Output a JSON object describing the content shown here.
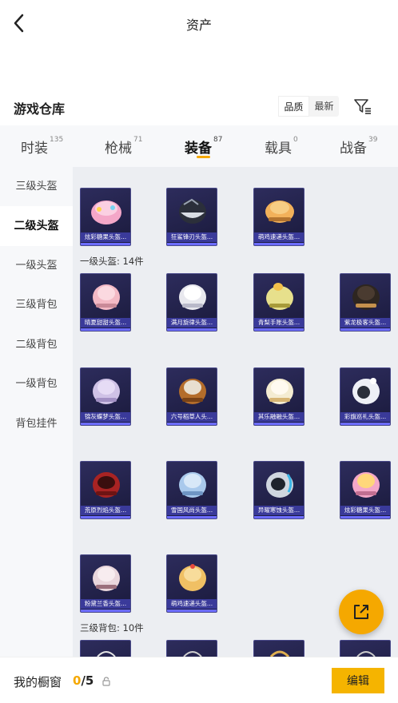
{
  "header": {
    "title": "资产",
    "back_icon": "chevron-left-icon"
  },
  "warehouse": {
    "title": "游戏仓库",
    "sort_options": [
      "品质",
      "最新"
    ],
    "filter_icon": "filter-icon"
  },
  "tabs": [
    {
      "label": "时装",
      "count": "135"
    },
    {
      "label": "枪械",
      "count": "71"
    },
    {
      "label": "装备",
      "count": "87",
      "active": true
    },
    {
      "label": "载具",
      "count": "0"
    },
    {
      "label": "战备",
      "count": "39"
    }
  ],
  "sidebar": [
    {
      "label": "三级头盔"
    },
    {
      "label": "二级头盔",
      "active": true
    },
    {
      "label": "一级头盔"
    },
    {
      "label": "三级背包"
    },
    {
      "label": "二级背包"
    },
    {
      "label": "一级背包"
    },
    {
      "label": "背包挂件"
    }
  ],
  "sections": {
    "level1_label": "一级头盔: 14件",
    "backpack3_label": "三级背包: 10件"
  },
  "items": {
    "row1": [
      "炫彩糖果头盔...",
      "狂鲨锋刃头盔...",
      "萌鸡速递头盔..."
    ],
    "row2": [
      "晴夏甜甜头盔...",
      "满月旋律头盔...",
      "青梨手账头盔...",
      "紫龙极客头盔..."
    ],
    "row3": [
      "锦灰蝶梦头盔...",
      "六号稻草人头...",
      "其乐融融头盔...",
      "彩旗巡礼头盔..."
    ],
    "row4": [
      "荒原烈焰头盔...",
      "雪国风尚头盔...",
      "异曜寒蚀头盔...",
      "炫彩糖果头盔..."
    ],
    "row5": [
      "粉黛兰香头盔...",
      "萌鸡速递头盔..."
    ]
  },
  "bottom": {
    "label": "我的橱窗",
    "count_current": "0",
    "count_total": "/5",
    "edit_label": "编辑",
    "lock_icon": "lock-icon"
  },
  "fab": {
    "icon": "share-external-icon"
  },
  "colors": {
    "accent": "#f5a800",
    "card_bg": "#1a1a3c",
    "caption_bg": "#3a3a9a"
  }
}
